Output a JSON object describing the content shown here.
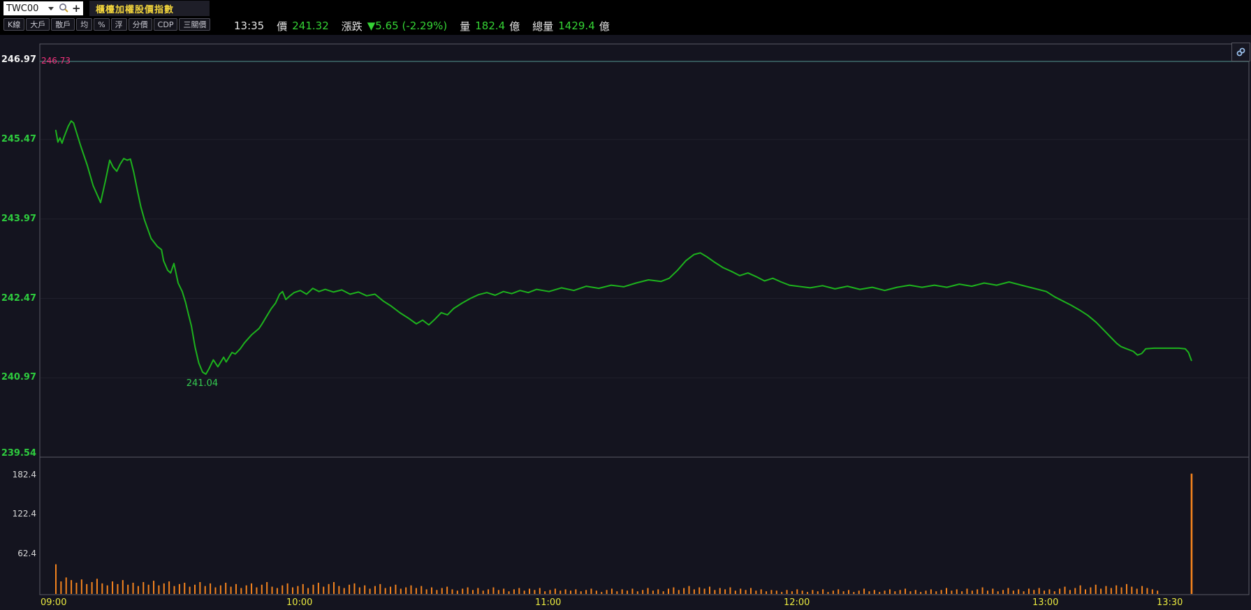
{
  "topbar": {
    "symbol": "TWC00",
    "tab": "櫃檯加權股價指數"
  },
  "toolbar": {
    "buttons": [
      "K線",
      "大戶",
      "散戶",
      "均",
      "%",
      "浮",
      "分價",
      "CDP",
      "三關價"
    ]
  },
  "status": {
    "time": "13:35",
    "price_label": "價",
    "price": "241.32",
    "change_label": "漲跌",
    "change": "▼5.65 (-2.29%)",
    "volume_label": "量",
    "volume": "182.4",
    "volume_unit": "億",
    "total_label": "總量",
    "total": "1429.4",
    "total_unit": "億"
  },
  "colors": {
    "price_line": "#1db31d",
    "volume_bar": "#f5841e",
    "ref_line": "#3e6c6c",
    "ref_label": "#f5317d",
    "axis_green": "#2ecb3e",
    "axis_yellow": "#e9e93f",
    "status_green": "#35d435",
    "tab_yellow": "#f2d43c",
    "pane_bg": "#14141f",
    "border": "#5a5a64",
    "grid": "#20202c"
  },
  "chart_data": {
    "type": "line",
    "title": "櫃檯加權股價指數 intraday price & volume",
    "x_axis": {
      "labels": [
        "09:00",
        "10:00",
        "11:00",
        "12:00",
        "13:00",
        "13:30"
      ],
      "minutes": [
        0,
        60,
        120,
        180,
        240,
        270
      ]
    },
    "price_axis": {
      "labels": [
        "246.97",
        "245.47",
        "243.97",
        "242.47",
        "240.97",
        "239.54"
      ],
      "values": [
        246.97,
        245.47,
        243.97,
        242.47,
        240.97,
        239.54
      ]
    },
    "volume_axis": {
      "labels": [
        "182.4",
        "122.4",
        "62.4"
      ],
      "values": [
        182.4,
        122.4,
        62.4
      ]
    },
    "reference_price": "246.73",
    "low_annotation": "241.04",
    "close": 241.32,
    "low": 241.04,
    "high": 245.82,
    "price_series": [
      [
        1,
        245.64
      ],
      [
        1.5,
        245.42
      ],
      [
        2,
        245.5
      ],
      [
        2.5,
        245.4
      ],
      [
        3,
        245.52
      ],
      [
        4,
        245.72
      ],
      [
        4.7,
        245.82
      ],
      [
        5.3,
        245.78
      ],
      [
        6,
        245.6
      ],
      [
        7,
        245.35
      ],
      [
        8.6,
        244.98
      ],
      [
        10,
        244.6
      ],
      [
        11.8,
        244.28
      ],
      [
        13,
        244.7
      ],
      [
        14,
        245.08
      ],
      [
        14.8,
        244.95
      ],
      [
        15.7,
        244.87
      ],
      [
        16.5,
        245.0
      ],
      [
        17.4,
        245.11
      ],
      [
        18.2,
        245.08
      ],
      [
        19,
        245.1
      ],
      [
        19.8,
        244.85
      ],
      [
        20.7,
        244.5
      ],
      [
        21.5,
        244.2
      ],
      [
        22.4,
        243.95
      ],
      [
        24,
        243.6
      ],
      [
        25.5,
        243.45
      ],
      [
        26.5,
        243.39
      ],
      [
        27,
        243.18
      ],
      [
        28,
        243.0
      ],
      [
        28.7,
        242.95
      ],
      [
        29.5,
        243.13
      ],
      [
        30.5,
        242.76
      ],
      [
        31.5,
        242.6
      ],
      [
        32.3,
        242.4
      ],
      [
        33,
        242.17
      ],
      [
        33.7,
        241.95
      ],
      [
        34.6,
        241.55
      ],
      [
        35.5,
        241.25
      ],
      [
        36.4,
        241.08
      ],
      [
        37.2,
        241.04
      ],
      [
        38,
        241.15
      ],
      [
        39,
        241.31
      ],
      [
        40.1,
        241.18
      ],
      [
        41.5,
        241.36
      ],
      [
        42.1,
        241.27
      ],
      [
        43.5,
        241.45
      ],
      [
        44.3,
        241.42
      ],
      [
        45.5,
        241.52
      ],
      [
        46.5,
        241.63
      ],
      [
        48.2,
        241.78
      ],
      [
        50,
        241.9
      ],
      [
        50.7,
        241.98
      ],
      [
        52,
        242.15
      ],
      [
        53,
        242.28
      ],
      [
        54,
        242.38
      ],
      [
        55,
        242.55
      ],
      [
        55.7,
        242.6
      ],
      [
        56.5,
        242.45
      ],
      [
        57.5,
        242.52
      ],
      [
        58.5,
        242.58
      ],
      [
        60,
        242.62
      ],
      [
        61.5,
        242.55
      ],
      [
        63,
        242.66
      ],
      [
        64.5,
        242.6
      ],
      [
        66,
        242.64
      ],
      [
        68,
        242.59
      ],
      [
        70,
        242.63
      ],
      [
        72,
        242.55
      ],
      [
        74,
        242.59
      ],
      [
        76,
        242.52
      ],
      [
        78,
        242.55
      ],
      [
        80,
        242.42
      ],
      [
        82,
        242.32
      ],
      [
        84,
        242.2
      ],
      [
        86,
        242.1
      ],
      [
        88,
        241.99
      ],
      [
        89.5,
        242.06
      ],
      [
        91,
        241.97
      ],
      [
        92.5,
        242.08
      ],
      [
        94,
        242.2
      ],
      [
        95.5,
        242.16
      ],
      [
        97,
        242.28
      ],
      [
        99,
        242.38
      ],
      [
        101,
        242.47
      ],
      [
        103,
        242.54
      ],
      [
        105,
        242.58
      ],
      [
        107,
        242.53
      ],
      [
        109,
        242.6
      ],
      [
        111,
        242.56
      ],
      [
        113,
        242.62
      ],
      [
        115,
        242.58
      ],
      [
        117,
        242.64
      ],
      [
        120,
        242.6
      ],
      [
        123,
        242.67
      ],
      [
        126,
        242.62
      ],
      [
        129,
        242.7
      ],
      [
        132,
        242.66
      ],
      [
        135,
        242.72
      ],
      [
        138,
        242.69
      ],
      [
        141,
        242.76
      ],
      [
        144,
        242.82
      ],
      [
        147,
        242.79
      ],
      [
        149,
        242.85
      ],
      [
        151,
        243.0
      ],
      [
        153,
        243.18
      ],
      [
        155,
        243.3
      ],
      [
        156.5,
        243.33
      ],
      [
        158,
        243.26
      ],
      [
        160,
        243.15
      ],
      [
        162,
        243.05
      ],
      [
        164,
        242.98
      ],
      [
        166,
        242.9
      ],
      [
        168,
        242.95
      ],
      [
        170,
        242.88
      ],
      [
        172,
        242.8
      ],
      [
        174,
        242.85
      ],
      [
        176,
        242.78
      ],
      [
        178,
        242.72
      ],
      [
        180,
        242.7
      ],
      [
        183,
        242.67
      ],
      [
        186,
        242.71
      ],
      [
        189,
        242.65
      ],
      [
        192,
        242.7
      ],
      [
        195,
        242.64
      ],
      [
        198,
        242.68
      ],
      [
        201,
        242.62
      ],
      [
        204,
        242.68
      ],
      [
        207,
        242.72
      ],
      [
        210,
        242.68
      ],
      [
        213,
        242.72
      ],
      [
        216,
        242.68
      ],
      [
        219,
        242.74
      ],
      [
        222,
        242.7
      ],
      [
        225,
        242.76
      ],
      [
        228,
        242.72
      ],
      [
        231,
        242.78
      ],
      [
        234,
        242.72
      ],
      [
        237,
        242.66
      ],
      [
        240,
        242.6
      ],
      [
        242,
        242.5
      ],
      [
        244,
        242.42
      ],
      [
        246,
        242.34
      ],
      [
        248,
        242.25
      ],
      [
        250,
        242.15
      ],
      [
        252,
        242.02
      ],
      [
        254,
        241.86
      ],
      [
        256,
        241.7
      ],
      [
        257,
        241.62
      ],
      [
        258,
        241.56
      ],
      [
        259,
        241.53
      ],
      [
        261,
        241.47
      ],
      [
        262,
        241.4
      ],
      [
        263,
        241.43
      ],
      [
        264,
        241.52
      ],
      [
        266,
        241.53
      ],
      [
        269,
        241.53
      ],
      [
        272,
        241.53
      ],
      [
        273.5,
        241.52
      ],
      [
        274.3,
        241.45
      ],
      [
        275,
        241.3
      ]
    ],
    "volume_series": [
      45,
      19,
      25,
      21,
      17,
      22,
      15,
      18,
      23,
      16,
      13,
      19,
      15,
      21,
      14,
      17,
      12,
      18,
      14,
      20,
      13,
      16,
      19,
      12,
      15,
      17,
      11,
      14,
      18,
      12,
      16,
      10,
      13,
      17,
      11,
      15,
      9,
      13,
      16,
      10,
      14,
      18,
      11,
      9,
      13,
      16,
      10,
      12,
      15,
      9,
      14,
      17,
      11,
      15,
      18,
      12,
      9,
      14,
      16,
      10,
      13,
      8,
      12,
      15,
      9,
      11,
      14,
      8,
      10,
      13,
      9,
      12,
      7,
      10,
      6,
      9,
      11,
      7,
      5,
      8,
      10,
      6,
      9,
      5,
      7,
      10,
      6,
      8,
      4,
      7,
      9,
      5,
      8,
      6,
      9,
      4,
      6,
      8,
      5,
      7,
      5,
      7,
      4,
      6,
      8,
      5,
      3,
      6,
      8,
      4,
      7,
      5,
      8,
      4,
      6,
      9,
      5,
      7,
      4,
      8,
      10,
      6,
      9,
      12,
      7,
      10,
      8,
      11,
      6,
      9,
      7,
      10,
      5,
      8,
      6,
      9,
      5,
      7,
      4,
      6,
      5,
      3,
      6,
      4,
      7,
      5,
      3,
      6,
      4,
      7,
      3,
      5,
      7,
      4,
      6,
      3,
      5,
      8,
      4,
      6,
      3,
      5,
      7,
      4,
      6,
      8,
      4,
      6,
      3,
      5,
      7,
      4,
      6,
      9,
      5,
      7,
      4,
      8,
      5,
      7,
      10,
      5,
      8,
      4,
      6,
      9,
      5,
      7,
      4,
      8,
      6,
      9,
      5,
      7,
      4,
      8,
      11,
      6,
      9,
      13,
      7,
      10,
      14,
      8,
      12,
      9,
      13,
      10,
      15,
      11,
      8,
      12,
      9,
      7,
      5
    ],
    "closing_auction": {
      "t": 275,
      "volume": 182.4
    }
  }
}
